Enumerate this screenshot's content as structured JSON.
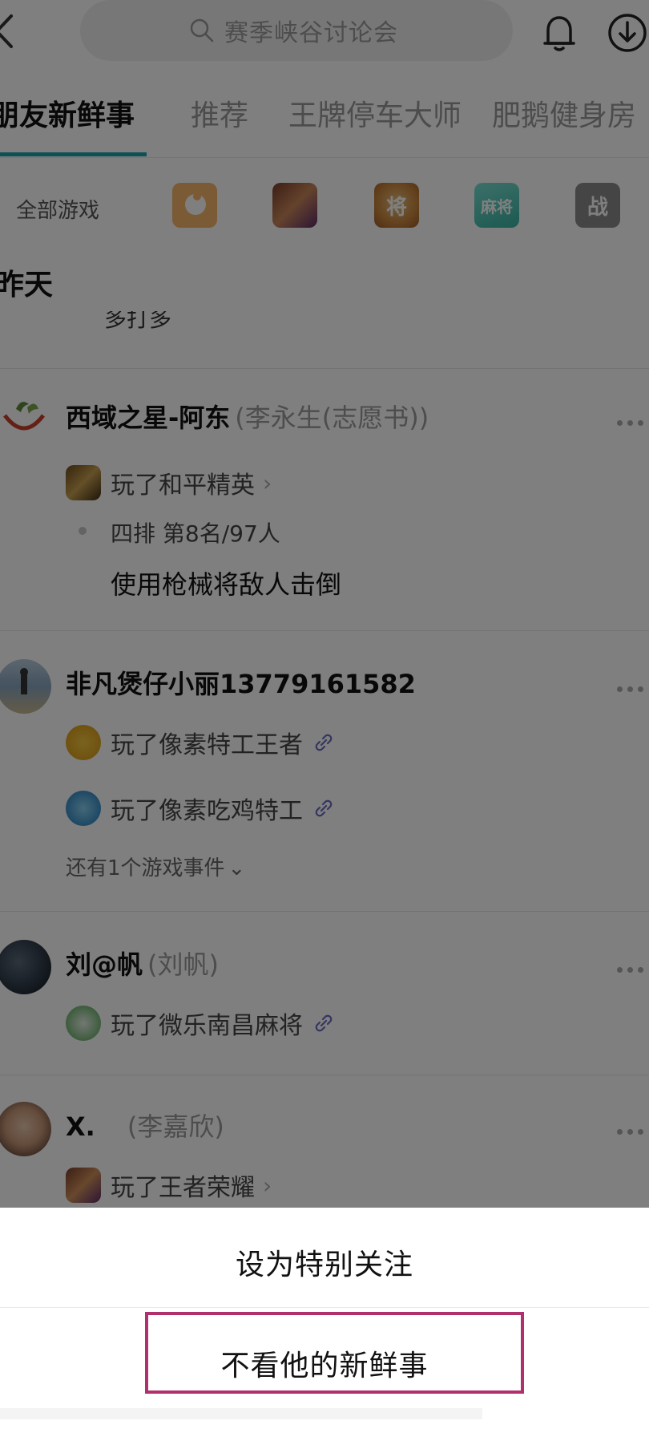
{
  "header": {
    "search_placeholder": "赛季峡谷讨论会"
  },
  "tabs": [
    {
      "label": "朋友新鲜事",
      "active": true
    },
    {
      "label": "推荐",
      "active": false
    },
    {
      "label": "王牌停车大师",
      "active": false
    },
    {
      "label": "肥鹅健身房",
      "active": false
    }
  ],
  "game_filter": {
    "all_label": "全部游戏",
    "icon_labels": [
      "将",
      "麻将",
      "战"
    ]
  },
  "section": {
    "date_label": "昨天",
    "partial_text": "多打多"
  },
  "feed": [
    {
      "name": "西域之星-阿东",
      "real_name": "(李永生(志愿书))",
      "events": [
        {
          "text": "玩了和平精英",
          "marker": "chevron"
        }
      ],
      "details": [
        "四排 第8名/97人",
        "使用枪械将敌人击倒"
      ]
    },
    {
      "name": "非凡煲仔小丽13779161582",
      "real_name": "",
      "events": [
        {
          "text": "玩了像素特工王者",
          "marker": "link"
        },
        {
          "text": "玩了像素吃鸡特工",
          "marker": "link"
        }
      ],
      "more_events": "还有1个游戏事件"
    },
    {
      "name": "刘@帆",
      "real_name": "(刘帆)",
      "events": [
        {
          "text": "玩了微乐南昌麻将",
          "marker": "link"
        }
      ]
    },
    {
      "name": "X.",
      "real_name": "(李嘉欣)",
      "events": [
        {
          "text": "玩了王者荣耀",
          "marker": "chevron"
        }
      ]
    }
  ],
  "sheet": {
    "option_1": "设为特别关注",
    "option_2": "不看他的新鲜事"
  },
  "colors": {
    "tab_indicator": "#1aa3a8",
    "highlight_border": "#b0306e",
    "overlay": "rgba(0,0,0,0.5)"
  }
}
